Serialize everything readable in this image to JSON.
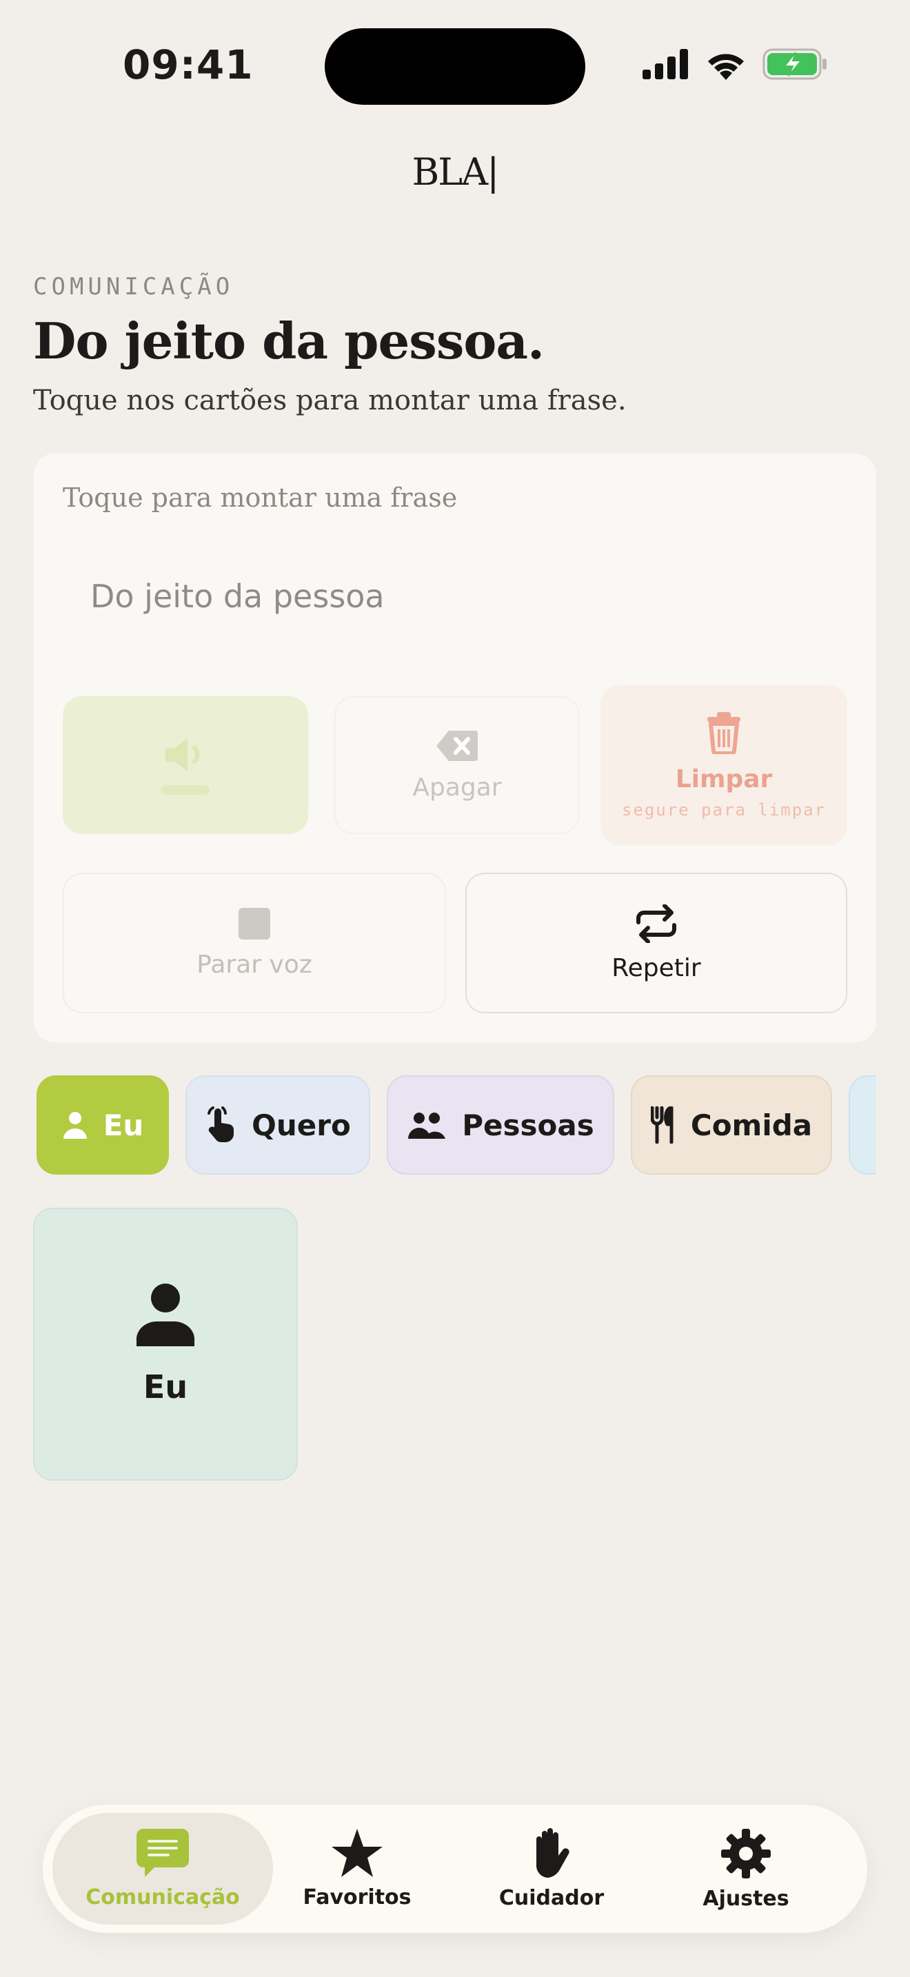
{
  "status_bar": {
    "time": "09:41"
  },
  "logo": {
    "text": "BLA|"
  },
  "header": {
    "eyebrow": "COMUNICAÇÃO",
    "title": "Do jeito da pessoa.",
    "subtitle": "Toque nos cartões para montar uma frase."
  },
  "phrase": {
    "hint": "Toque para montar uma frase",
    "placeholder": "Do jeito da pessoa"
  },
  "actions": {
    "erase_label": "Apagar",
    "clear_label": "Limpar",
    "clear_sub": "segure para limpar",
    "stop_label": "Parar voz",
    "repeat_label": "Repetir"
  },
  "categories": [
    {
      "label": "Eu",
      "icon": "person-icon",
      "selected": true
    },
    {
      "label": "Quero",
      "icon": "pointing-hand-icon"
    },
    {
      "label": "Pessoas",
      "icon": "people-icon"
    },
    {
      "label": "Comida",
      "icon": "utensils-icon"
    }
  ],
  "cards": [
    {
      "label": "Eu",
      "icon": "person-icon"
    }
  ],
  "nav": {
    "items": [
      {
        "label": "Comunicação",
        "icon": "chat-icon",
        "active": true
      },
      {
        "label": "Favoritos",
        "icon": "star-icon"
      },
      {
        "label": "Cuidador",
        "icon": "hand-icon"
      },
      {
        "label": "Ajustes",
        "icon": "gear-icon"
      }
    ]
  },
  "colors": {
    "accent": "#b2cb41",
    "background": "#f2efea",
    "clear_red": "#e9a38f"
  }
}
